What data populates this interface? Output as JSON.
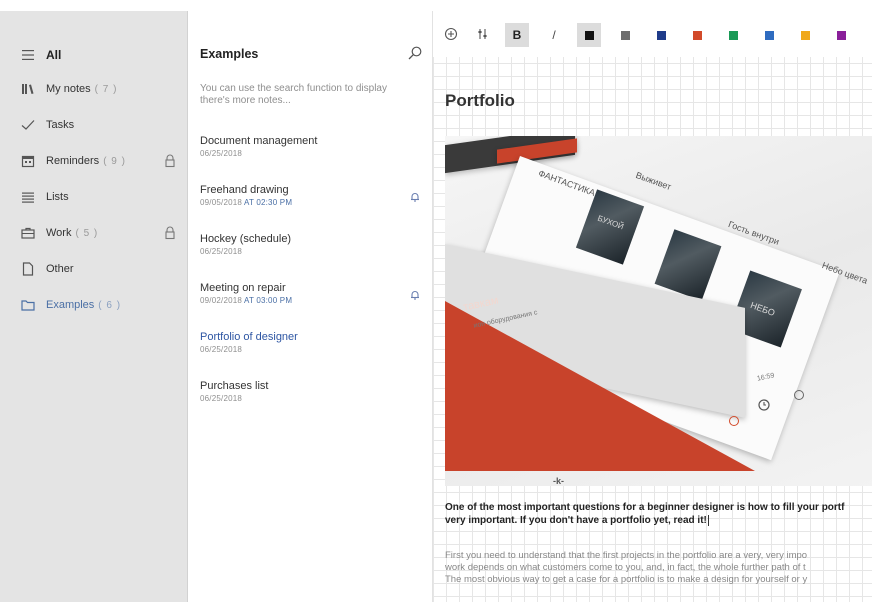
{
  "sidebar": {
    "items": [
      {
        "label": "All",
        "count": "",
        "icon": "hamburger-icon"
      },
      {
        "label": "My notes",
        "count": "( 7 )",
        "icon": "books-icon"
      },
      {
        "label": "Tasks",
        "count": "",
        "icon": "checkmark-icon"
      },
      {
        "label": "Reminders",
        "count": "( 9 )",
        "icon": "calendar-icon",
        "locked": true
      },
      {
        "label": "Lists",
        "count": "",
        "icon": "list-icon"
      },
      {
        "label": "Work",
        "count": "( 5 )",
        "icon": "briefcase-icon",
        "locked": true
      },
      {
        "label": "Other",
        "count": "",
        "icon": "document-icon"
      },
      {
        "label": "Examples",
        "count": "( 6 )",
        "icon": "folder-icon",
        "active": true
      }
    ]
  },
  "notes": {
    "title": "Examples",
    "hint": "You can use the search function to display there's more notes...",
    "items": [
      {
        "title": "Document management",
        "date": "06/25/2018",
        "at": ""
      },
      {
        "title": "Freehand drawing",
        "date": "09/05/2018",
        "at": "AT 02:30 PM",
        "reminder": true
      },
      {
        "title": "Hockey (schedule)",
        "date": "06/25/2018",
        "at": ""
      },
      {
        "title": "Meeting on repair",
        "date": "09/02/2018",
        "at": "AT 03:00 PM",
        "reminder": true
      },
      {
        "title": "Portfolio of designer",
        "date": "06/25/2018",
        "at": "",
        "selected": true
      },
      {
        "title": "Purchases list",
        "date": "06/25/2018",
        "at": ""
      }
    ]
  },
  "toolbar": {
    "add_icon": "plus-circle-icon",
    "format_icon": "text-format-icon",
    "bold_label": "B",
    "italic_label": "/",
    "colors": [
      "#111111",
      "#6d6d6d",
      "#1f3c8a",
      "#d24a2a",
      "#1a9a56",
      "#2f6cc0",
      "#f0a81a",
      "#8a1f9a"
    ]
  },
  "document": {
    "title": "Portfolio",
    "image_texts": {
      "tag1": "ФАНТАСТИКА",
      "tag2": "Выживет",
      "tag3": "Гость внутри",
      "tag4": "Небо цвета",
      "tag5": "НЕБО",
      "tag6": "БУХОЙ",
      "red_text1": "тавкам",
      "red_text2": "ион оборудования с",
      "time": "16:59",
      "k_mark": "-k-"
    },
    "bold_line1": "One of the most important questions for a beginner designer is how to fill your portf",
    "bold_line2": "very important. If you don't have a portfolio yet, read it!",
    "para_line1": "First you need to understand that the first projects in the portfolio are a very, very impo",
    "para_line2": "work depends on what customers come to you, and, in fact, the whole further path of t",
    "para_line3": "The most obvious way to get a case for a portfolio is to make a design for yourself or y"
  }
}
